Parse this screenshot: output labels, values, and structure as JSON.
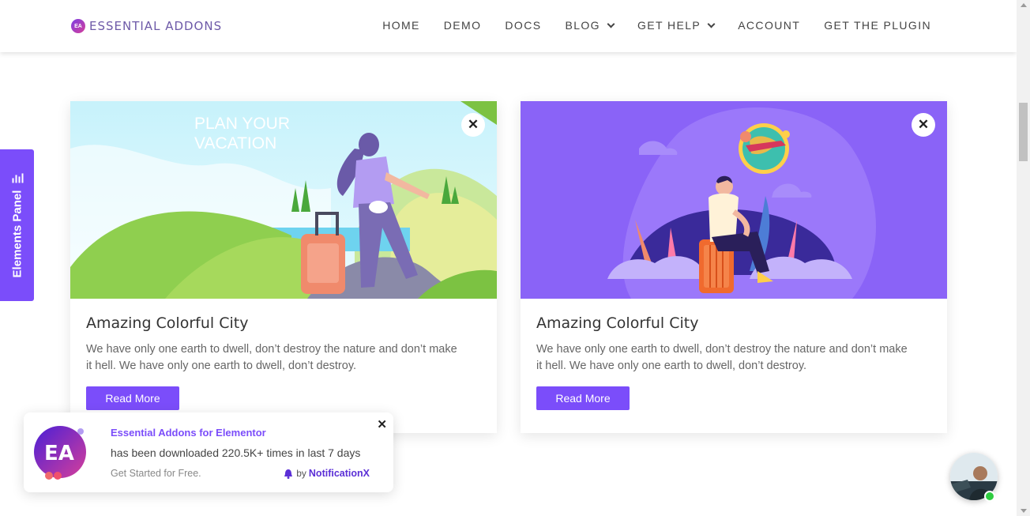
{
  "header": {
    "logo_text": "ESSENTIAL ADDONS",
    "logo_mark": "EA",
    "nav": [
      {
        "label": "HOME",
        "dropdown": false
      },
      {
        "label": "DEMO",
        "dropdown": false
      },
      {
        "label": "DOCS",
        "dropdown": false
      },
      {
        "label": "BLOG",
        "dropdown": true
      },
      {
        "label": "GET HELP",
        "dropdown": true
      },
      {
        "label": "ACCOUNT",
        "dropdown": false
      },
      {
        "label": "GET THE PLUGIN",
        "dropdown": false
      }
    ]
  },
  "side_tab": {
    "label": "Elements Panel",
    "icon": "bar-chart-icon"
  },
  "cards": [
    {
      "image_text_line1": "PLAN YOUR",
      "image_text_line2": "VACATION",
      "title": "Amazing Colorful City",
      "text": "We have only one earth to dwell, don’t destroy the nature and don’t make it hell. We have only one earth to dwell, don’t destroy.",
      "button": "Read More"
    },
    {
      "title": "Amazing Colorful City",
      "text": "We have only one earth to dwell, don’t destroy the nature and don’t make it hell. We have only one earth to dwell, don’t destroy.",
      "button": "Read More"
    }
  ],
  "notification": {
    "title": "Essential Addons for Elementor",
    "text": "has been downloaded 220.5K+ times in last 7 days",
    "sub": "Get Started for Free.",
    "by_prefix": "by",
    "by_brand": "NotificationX",
    "logo_text": "EA"
  },
  "colors": {
    "accent": "#7b4dfa",
    "card2_bg": "#8a63f7",
    "sky": "#bdeefa",
    "online": "#2ecc40"
  }
}
